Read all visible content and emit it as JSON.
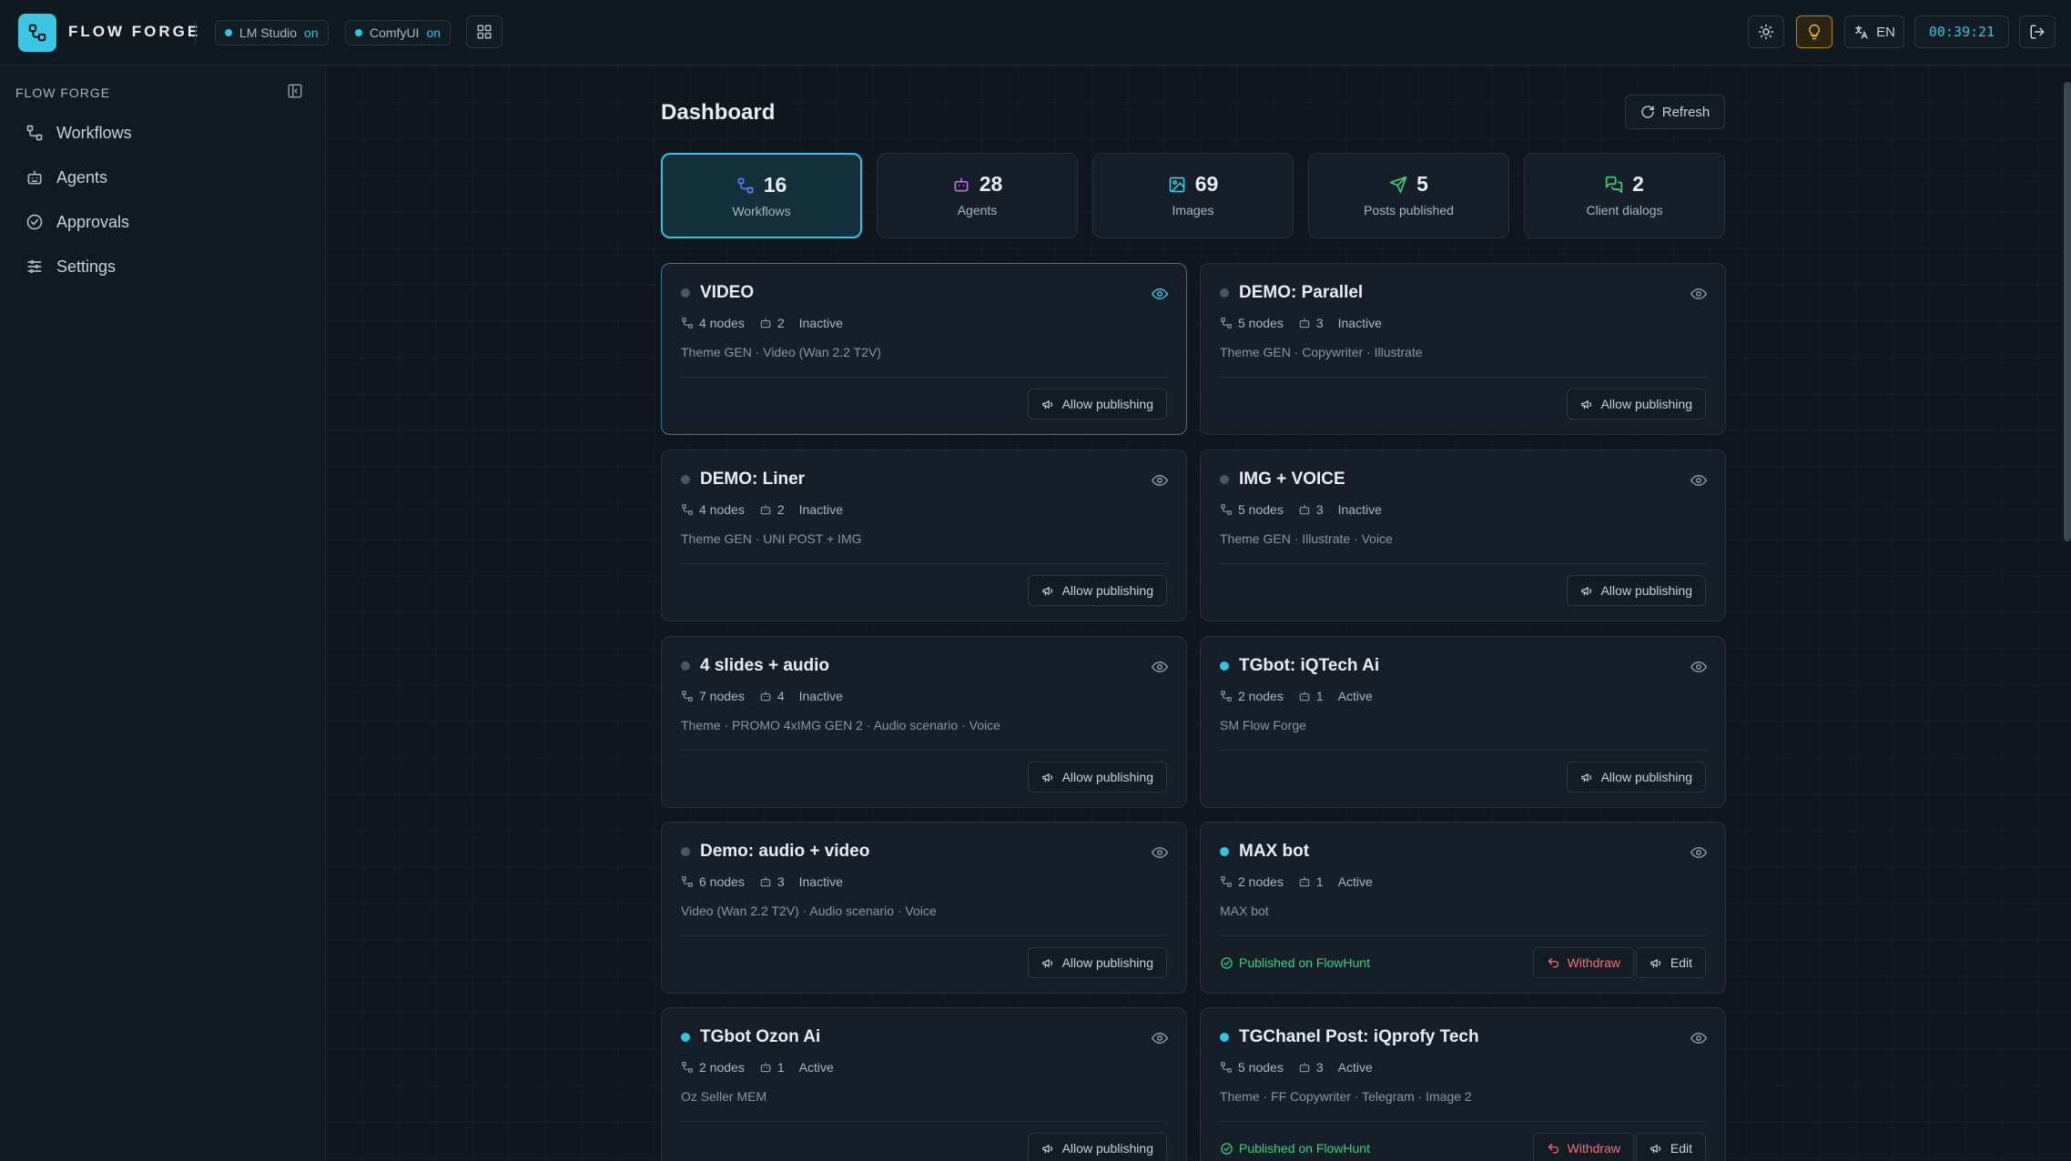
{
  "topbar": {
    "brand": "FLOW FORGE",
    "services": [
      {
        "name": "LM Studio",
        "status": "on"
      },
      {
        "name": "ComfyUI",
        "status": "on"
      }
    ],
    "language": "EN",
    "clock": "00:39:21"
  },
  "sidebar": {
    "title": "FLOW FORGE",
    "items": [
      {
        "label": "Workflows",
        "icon": "workflow-icon"
      },
      {
        "label": "Agents",
        "icon": "robot-icon"
      },
      {
        "label": "Approvals",
        "icon": "check-circle-icon"
      },
      {
        "label": "Settings",
        "icon": "sliders-icon"
      }
    ]
  },
  "main": {
    "title": "Dashboard",
    "refresh_label": "Refresh",
    "stats": [
      {
        "value": "16",
        "label": "Workflows",
        "icon": "workflow-icon",
        "color": "#5b7cfa"
      },
      {
        "value": "28",
        "label": "Agents",
        "icon": "robot-icon",
        "color": "#c06cf0"
      },
      {
        "value": "69",
        "label": "Images",
        "icon": "image-icon",
        "color": "#3bc6e3"
      },
      {
        "value": "5",
        "label": "Posts published",
        "icon": "send-icon",
        "color": "#3ad27c"
      },
      {
        "value": "2",
        "label": "Client dialogs",
        "icon": "chat-icon",
        "color": "#3ad27c"
      }
    ],
    "cards": [
      {
        "title": "VIDEO",
        "nodes": "4 nodes",
        "agents": "2",
        "status": "Inactive",
        "desc": "Theme GEN · Video (Wan 2.2 T2V)",
        "allow": "Allow publishing"
      },
      {
        "title": "DEMO: Parallel",
        "nodes": "5 nodes",
        "agents": "3",
        "status": "Inactive",
        "desc": "Theme GEN · Copywriter · Illustrate",
        "allow": "Allow publishing"
      },
      {
        "title": "DEMO: Liner",
        "nodes": "4 nodes",
        "agents": "2",
        "status": "Inactive",
        "desc": "Theme GEN · UNI POST + IMG",
        "allow": "Allow publishing"
      },
      {
        "title": "IMG + VOICE",
        "nodes": "5 nodes",
        "agents": "3",
        "status": "Inactive",
        "desc": "Theme GEN · Illustrate · Voice",
        "allow": "Allow publishing"
      },
      {
        "title": "4 slides + audio",
        "nodes": "7 nodes",
        "agents": "4",
        "status": "Inactive",
        "desc": "Theme · PROMO 4xIMG GEN 2 · Audio scenario · Voice",
        "allow": "Allow publishing"
      },
      {
        "title": "TGbot: iQTech Ai",
        "nodes": "2 nodes",
        "agents": "1",
        "status": "Active",
        "desc": "SM Flow Forge",
        "allow": "Allow publishing"
      },
      {
        "title": "Demo: audio + video",
        "nodes": "6 nodes",
        "agents": "3",
        "status": "Inactive",
        "desc": "Video (Wan 2.2 T2V) · Audio scenario · Voice",
        "allow": "Allow publishing"
      },
      {
        "title": "MAX bot",
        "nodes": "2 nodes",
        "agents": "1",
        "status": "Active",
        "desc": "MAX bot",
        "published": "Published on FlowHunt",
        "withdraw": "Withdraw",
        "edit": "Edit"
      },
      {
        "title": "TGbot Ozon Ai",
        "nodes": "2 nodes",
        "agents": "1",
        "status": "Active",
        "desc": "Oz Seller MEM",
        "allow": "Allow publishing"
      },
      {
        "title": "TGChanel Post: iQprofy Tech",
        "nodes": "5 nodes",
        "agents": "3",
        "status": "Active",
        "desc": "Theme · FF Copywriter · Telegram · Image 2",
        "published": "Published on FlowHunt",
        "withdraw": "Withdraw",
        "edit": "Edit"
      }
    ]
  },
  "colors": {
    "accent": "#2ec6e6",
    "success": "#3ad27c",
    "danger": "#f2707a"
  }
}
